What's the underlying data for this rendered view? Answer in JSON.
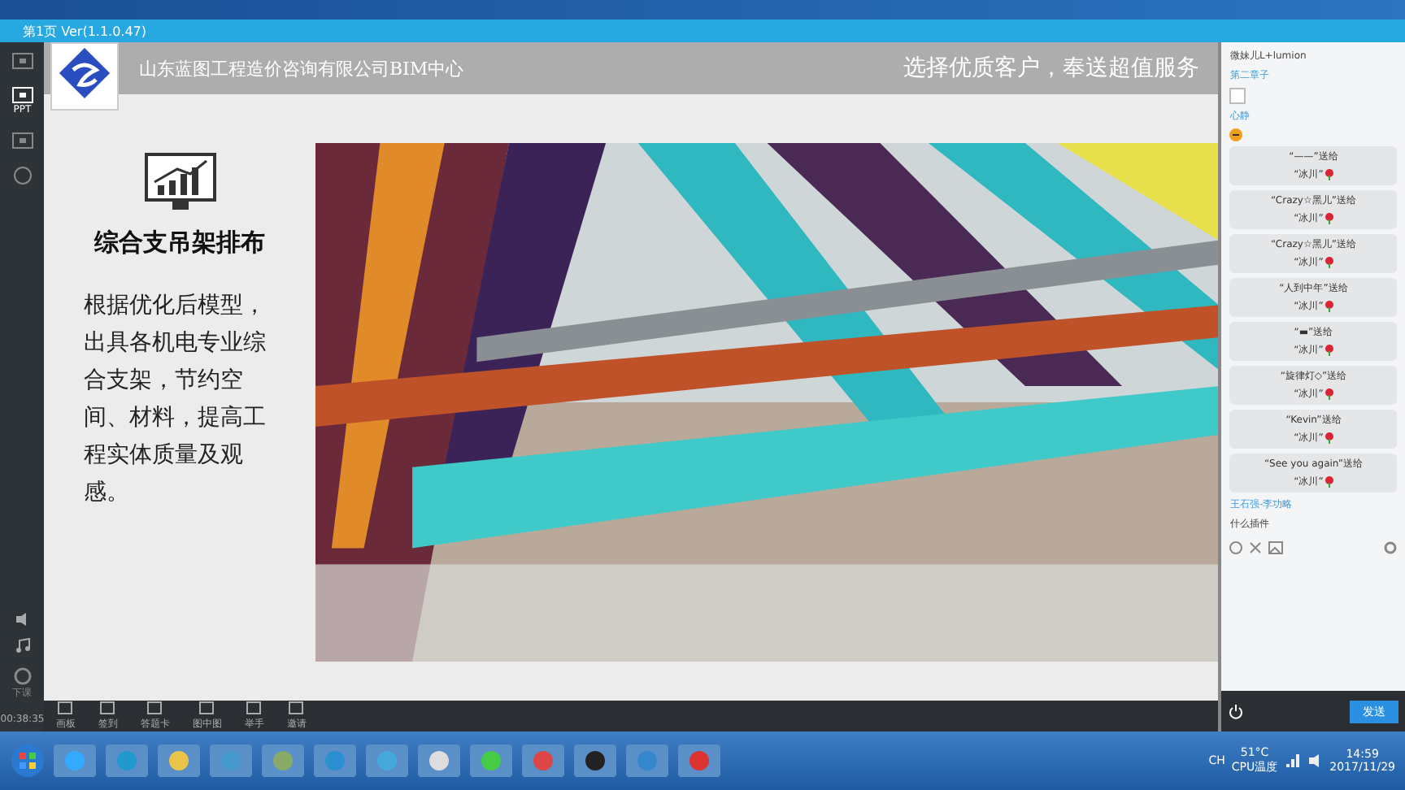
{
  "window": {
    "title": "第1页 Ver(1.1.0.47)"
  },
  "sidebar": {
    "items": [
      {
        "kind": "screen",
        "selected": false
      },
      {
        "label": "PPT",
        "kind": "ppt",
        "selected": true
      },
      {
        "kind": "video",
        "selected": false
      },
      {
        "kind": "mic",
        "selected": false
      }
    ],
    "exit_label": "下课",
    "timer": "00:38:35"
  },
  "slide": {
    "company": "山东蓝图工程造价咨询有限公司BIM中心",
    "slogan": "选择优质客户，奉送超值服务",
    "heading": "综合支吊架排布",
    "body": "根据优化后模型，出具各机电专业综合支架，节约空间、材料，提高工程实体质量及观感。"
  },
  "chat": {
    "header": "微妹儿L+lumion",
    "user": "第二章子",
    "user2": "心静",
    "gifts": [
      {
        "from": "“——”送给",
        "to": "“冰川”"
      },
      {
        "from": "“Crazy☆黑儿”送给",
        "to": "“冰川”"
      },
      {
        "from": "“Crazy☆黑儿”送给",
        "to": "“冰川”"
      },
      {
        "from": "“人到中年”送给",
        "to": "“冰川”"
      },
      {
        "from": "“▬”送给",
        "to": "“冰川”"
      },
      {
        "from": "“旋律灯◇”送给",
        "to": "“冰川”"
      },
      {
        "from": "“Kevin”送给",
        "to": "“冰川”"
      },
      {
        "from": "“See you again”送给",
        "to": "“冰川”"
      }
    ],
    "last_sender": "王石强-李功略",
    "last_message": "什么插件",
    "send": "发送"
  },
  "toolbar": [
    "画板",
    "签到",
    "答题卡",
    "图中图",
    "举手",
    "邀请"
  ],
  "taskbar": {
    "lang": "CH",
    "temp": "51°C",
    "temp_label": "CPU温度",
    "time": "14:59",
    "date": "2017/11/29"
  }
}
